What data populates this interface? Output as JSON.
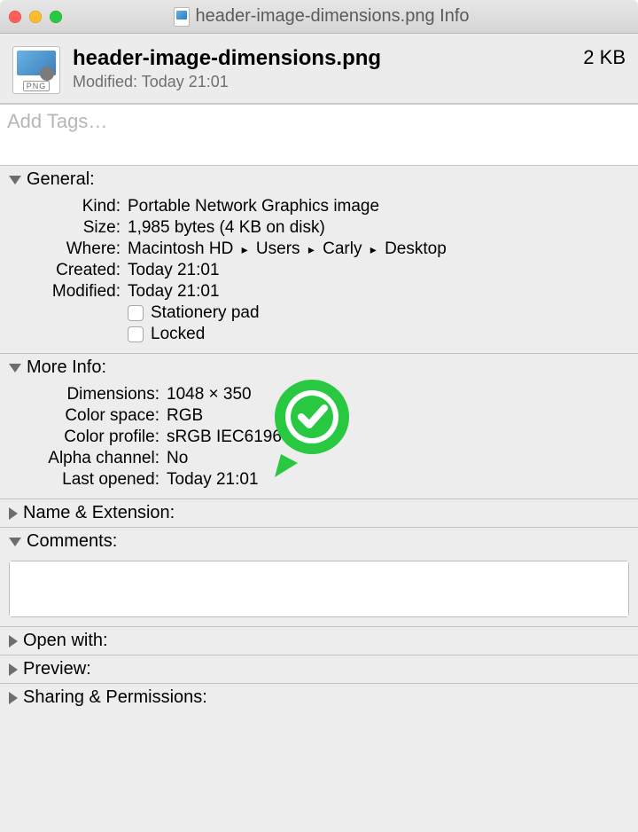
{
  "window": {
    "title": "header-image-dimensions.png Info"
  },
  "header": {
    "filename": "header-image-dimensions.png",
    "modified_label": "Modified:",
    "modified_value": "Today 21:01",
    "size": "2 KB",
    "thumb_badge": "PNG"
  },
  "tags": {
    "placeholder": "Add Tags…"
  },
  "sections": {
    "general": {
      "title": "General:",
      "kind_label": "Kind:",
      "kind_value": "Portable Network Graphics image",
      "size_label": "Size:",
      "size_value": "1,985 bytes (4 KB on disk)",
      "where_label": "Where:",
      "where_parts": [
        "Macintosh HD",
        "Users",
        "Carly",
        "Desktop"
      ],
      "created_label": "Created:",
      "created_value": "Today 21:01",
      "modified_label": "Modified:",
      "modified_value": "Today 21:01",
      "stationery_label": "Stationery pad",
      "locked_label": "Locked"
    },
    "moreinfo": {
      "title": "More Info:",
      "dimensions_label": "Dimensions:",
      "dimensions_value": "1048 × 350",
      "colorspace_label": "Color space:",
      "colorspace_value": "RGB",
      "colorprofile_label": "Color profile:",
      "colorprofile_value": "sRGB IEC61966-2.1",
      "alpha_label": "Alpha channel:",
      "alpha_value": "No",
      "lastopened_label": "Last opened:",
      "lastopened_value": "Today 21:01"
    },
    "nameext": {
      "title": "Name & Extension:"
    },
    "comments": {
      "title": "Comments:"
    },
    "openwith": {
      "title": "Open with:"
    },
    "preview": {
      "title": "Preview:"
    },
    "sharing": {
      "title": "Sharing & Permissions:"
    }
  }
}
